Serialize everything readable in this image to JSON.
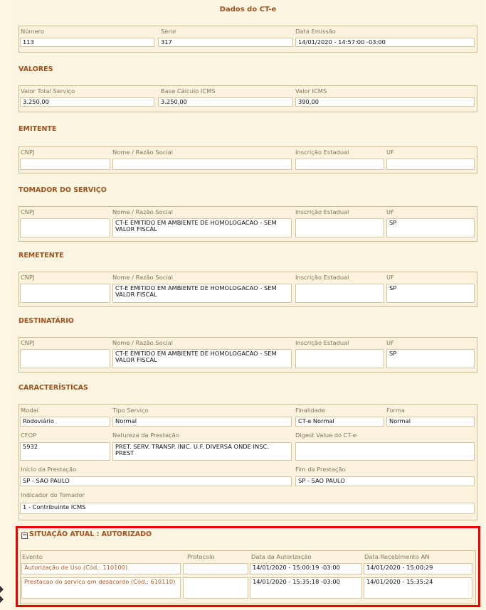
{
  "title": "Dados do CT-e",
  "doc": {
    "h_numero": "Número",
    "h_serie": "Série",
    "h_data": "Data Emissão",
    "numero": "113",
    "serie": "317",
    "data_emissao": "14/01/2020 - 14:57:00 -03:00"
  },
  "valores": {
    "title": "VALORES",
    "h_total": "Valor Total Serviço",
    "h_base": "Base Cálculo ICMS",
    "h_icms": "Valor ICMS",
    "total": "3.250,00",
    "base": "3.250,00",
    "icms": "390,00"
  },
  "emitente": {
    "title": "EMITENTE",
    "h_cnpj": "CNPJ",
    "h_nome": "Nome / Razão Social",
    "h_ie": "Inscrição Estadual",
    "h_uf": "UF",
    "cnpj": "",
    "nome": "",
    "ie": "",
    "uf": ""
  },
  "tomador": {
    "title": "TOMADOR DO SERVIÇO",
    "h_cnpj": "CNPJ",
    "h_nome": "Nome / Razão Social",
    "h_ie": "Inscrição Estadual",
    "h_uf": "UF",
    "cnpj": "",
    "nome": "CT-E EMITIDO EM AMBIENTE DE HOMOLOGACAO - SEM VALOR FISCAL",
    "ie": "",
    "uf": "SP"
  },
  "remetente": {
    "title": "REMETENTE",
    "h_cnpj": "CNPJ",
    "h_nome": "Nome / Razão Social",
    "h_ie": "Inscrição Estadual",
    "h_uf": "UF",
    "cnpj": "",
    "nome": "CT-E EMITIDO EM AMBIENTE DE HOMOLOGACAO - SEM VALOR FISCAL",
    "ie": "",
    "uf": "SP"
  },
  "destinatario": {
    "title": "DESTINATÁRIO",
    "h_cnpj": "CNPJ",
    "h_nome": "Nome / Razão Social",
    "h_ie": "Inscrição Estadual",
    "h_uf": "UF",
    "cnpj": "",
    "nome": "CT-E EMITIDO EM AMBIENTE DE HOMOLOGACAO - SEM VALOR FISCAL",
    "ie": "",
    "uf": "SP"
  },
  "caracteristicas": {
    "title": "CARACTERÍSTICAS",
    "h_modal": "Modal",
    "h_tipo": "Tipo Serviço",
    "h_final": "Finalidade",
    "h_forma": "Forma",
    "modal": "Rodoviário",
    "tipo": "Normal",
    "finalidade": "CT-e Normal",
    "forma": "Normal",
    "h_cfop": "CFOP",
    "h_natureza": "Natureza da Prestação",
    "h_digest": "Digest Value do CT-e",
    "cfop": "5932",
    "natureza": "PRET. SERV. TRANSP. INIC. U.F. DIVERSA ONDE INSC. PREST",
    "digest": "",
    "h_inicio": "Início da Prestação",
    "h_fim": "Fim da Prestação",
    "inicio": "SP - SAO PAULO",
    "fim": "SP - SAO PAULO",
    "h_indicador": "Indicador do Tomador",
    "indicador": "1 - Contribuinte ICMS"
  },
  "situacao": {
    "title": "SITUAÇÃO ATUAL : AUTORIZADO",
    "toggle": "−",
    "h_evento": "Evento",
    "h_protocolo": "Protocolo",
    "h_data_aut": "Data da Autorização",
    "h_data_rec": "Data Recebimento AN",
    "eventos": [
      {
        "evento": "Autorização de Uso (Cód.: 110100)",
        "protocolo": "",
        "data_aut": "14/01/2020 - 15:00:19 -03:00",
        "data_rec": "14/01/2020 - 15:00:29"
      },
      {
        "evento": "Prestacao do servico em desacordo (Cód.: 610110)",
        "protocolo": "",
        "data_aut": "14/01/2020 - 15:35:18 -03:00",
        "data_rec": "14/01/2020 - 15:35:24"
      }
    ]
  }
}
